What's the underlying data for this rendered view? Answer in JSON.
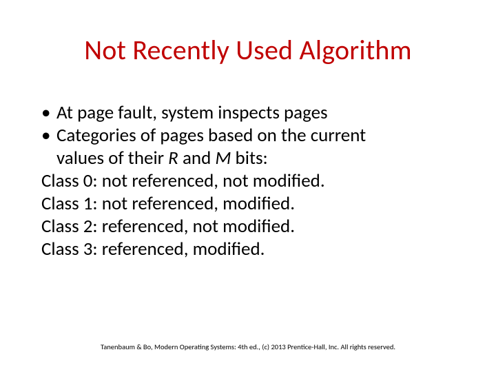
{
  "title": "Not Recently Used Algorithm",
  "bullets": [
    "At page fault, system inspects pages",
    "Categories of pages based on the current values of their R and M bits:"
  ],
  "bullet1_line1": "Categories of pages based on the current",
  "bullet1_line2_prefix": "values of their ",
  "bullet1_line2_r": "R",
  "bullet1_line2_mid": " and ",
  "bullet1_line2_m": "M",
  "bullet1_line2_suffix": " bits:",
  "classes": [
    "Class 0: not referenced, not modified.",
    "Class 1: not referenced, modified.",
    "Class 2: referenced, not modified.",
    "Class 3: referenced, modified."
  ],
  "footer": "Tanenbaum & Bo, Modern Operating Systems: 4th ed., (c) 2013 Prentice-Hall, Inc. All rights reserved."
}
